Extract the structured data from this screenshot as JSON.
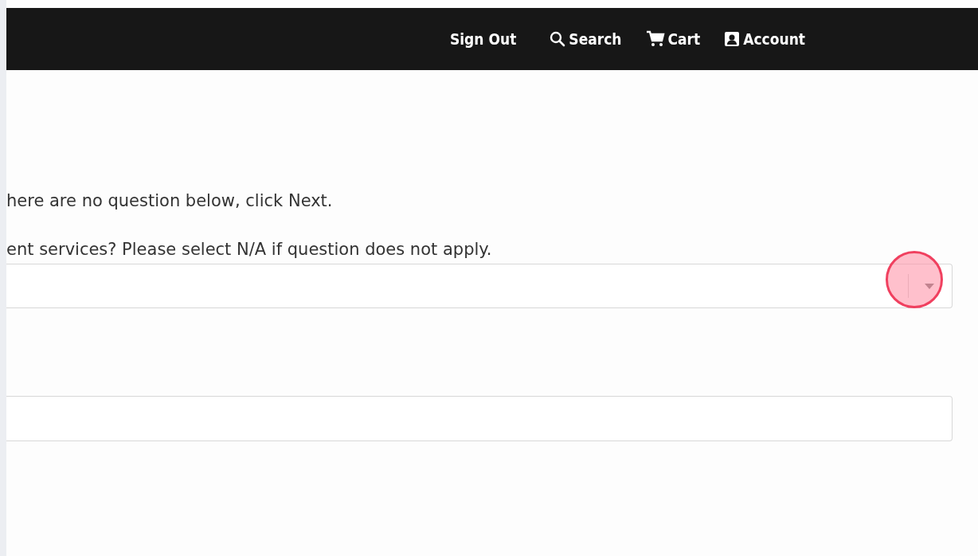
{
  "nav": [
    {
      "kind": "text",
      "label": "Sign Out"
    },
    {
      "kind": "search",
      "label": "Search"
    },
    {
      "kind": "cart",
      "label": "Cart"
    },
    {
      "kind": "account",
      "label": "Account"
    }
  ],
  "instruction": "here are no question below, click Next.",
  "question": {
    "label": "ent services? Please select N/A if question does not apply."
  },
  "click_marker": true
}
